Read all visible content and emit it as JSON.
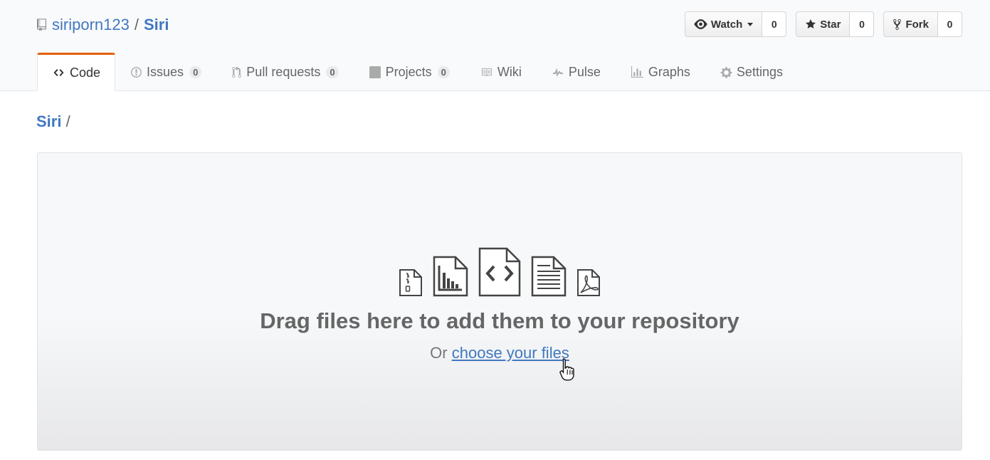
{
  "repo": {
    "owner": "siriporn123",
    "separator": "/",
    "name": "Siri"
  },
  "actions": {
    "watch": {
      "label": "Watch",
      "count": "0",
      "icon": "eye-icon"
    },
    "star": {
      "label": "Star",
      "count": "0",
      "icon": "star-icon"
    },
    "fork": {
      "label": "Fork",
      "count": "0",
      "icon": "fork-icon"
    }
  },
  "tabs": [
    {
      "label": "Code",
      "icon": "code-icon",
      "selected": true
    },
    {
      "label": "Issues",
      "count": "0",
      "icon": "issue-opened-icon"
    },
    {
      "label": "Pull requests",
      "count": "0",
      "icon": "git-pull-request-icon"
    },
    {
      "label": "Projects",
      "count": "0",
      "icon": "project-icon"
    },
    {
      "label": "Wiki",
      "icon": "book-icon"
    },
    {
      "label": "Pulse",
      "icon": "pulse-icon"
    },
    {
      "label": "Graphs",
      "icon": "graph-icon"
    },
    {
      "label": "Settings",
      "icon": "gear-icon"
    }
  ],
  "breadcrumb": {
    "root": "Siri",
    "separator": "/"
  },
  "dropzone": {
    "heading": "Drag files here to add them to your repository",
    "prefix": "Or",
    "link": "choose your files"
  },
  "colors": {
    "link": "#4078c0",
    "selected_tab_accent": "#e36209",
    "counter_bg": "#eaeaea"
  }
}
